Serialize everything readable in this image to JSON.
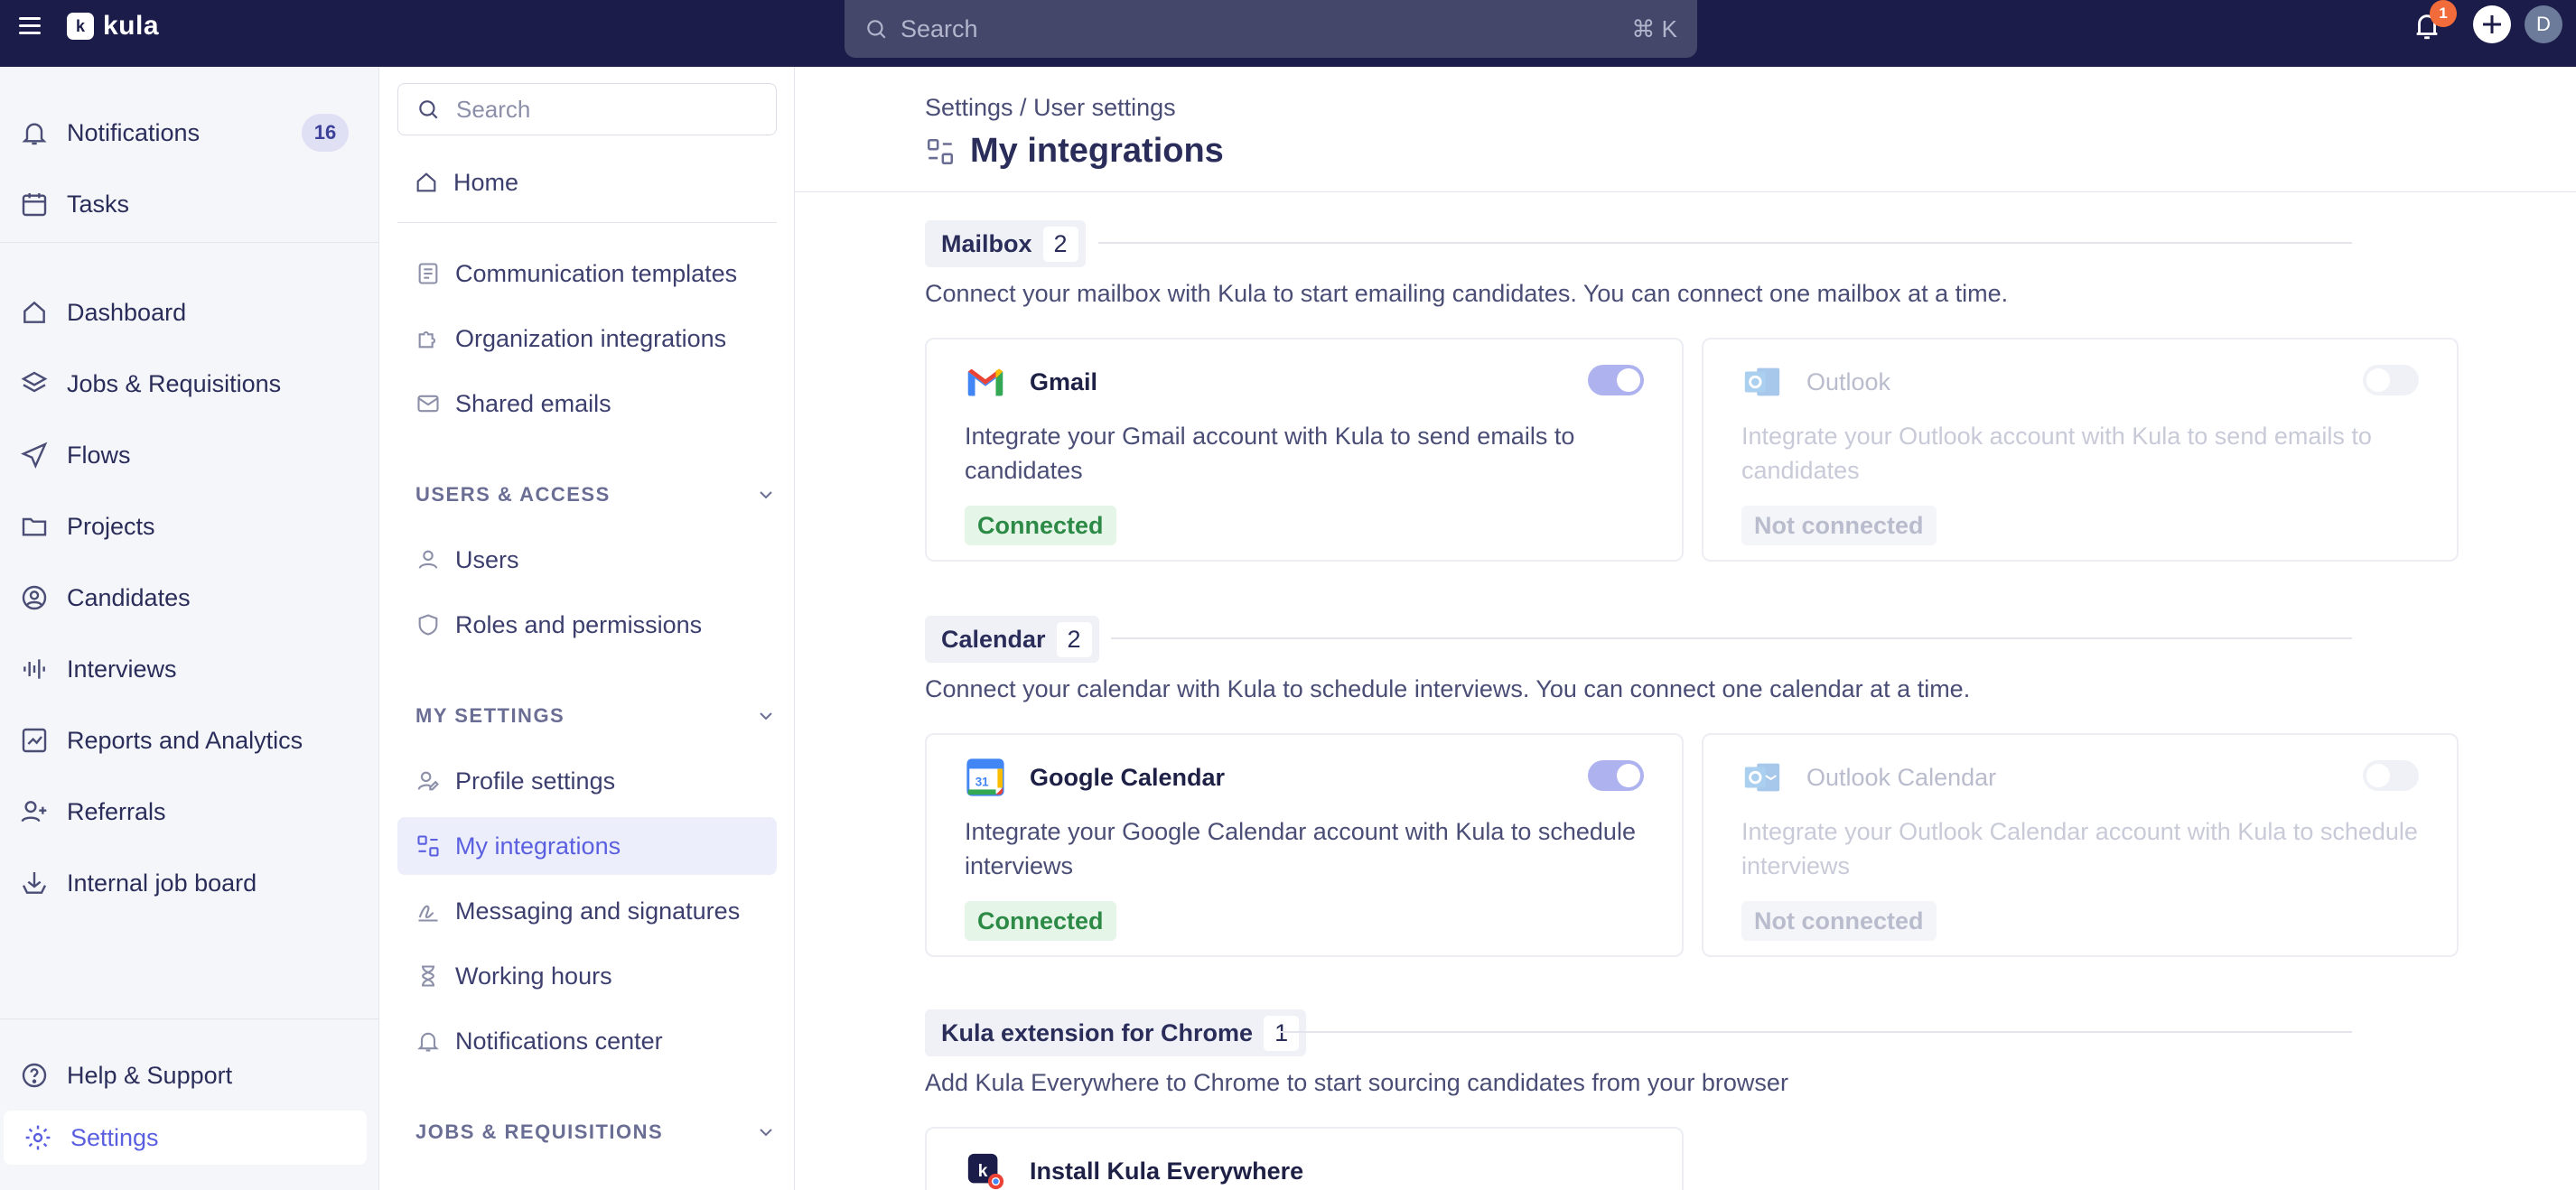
{
  "app": {
    "name": "kula",
    "logo_mark": "k"
  },
  "topbar": {
    "search_placeholder": "Search",
    "shortcut": "⌘ K",
    "notif_badge": "1",
    "avatar_initial": "D"
  },
  "leftnav": {
    "items": [
      {
        "label": "Notifications",
        "icon": "bell-icon",
        "count": "16"
      },
      {
        "label": "Tasks",
        "icon": "calendar-check-icon"
      },
      {
        "label": "Dashboard",
        "icon": "home-icon"
      },
      {
        "label": "Jobs & Requisitions",
        "icon": "layers-icon"
      },
      {
        "label": "Flows",
        "icon": "send-icon"
      },
      {
        "label": "Projects",
        "icon": "folder-icon"
      },
      {
        "label": "Candidates",
        "icon": "user-circle-icon"
      },
      {
        "label": "Interviews",
        "icon": "audio-bars-icon"
      },
      {
        "label": "Reports and Analytics",
        "icon": "chart-icon"
      },
      {
        "label": "Referrals",
        "icon": "user-plus-icon"
      },
      {
        "label": "Internal job board",
        "icon": "inbox-stack-icon"
      }
    ],
    "help_label": "Help & Support",
    "settings_label": "Settings"
  },
  "subnav": {
    "search_placeholder": "Search",
    "home": "Home",
    "org_items": [
      "Communication templates",
      "Organization integrations",
      "Shared emails"
    ],
    "users_section": "USERS & ACCESS",
    "users_items": [
      "Users",
      "Roles and permissions"
    ],
    "my_section": "MY SETTINGS",
    "my_items": [
      "Profile settings",
      "My integrations",
      "Messaging and signatures",
      "Working hours",
      "Notifications center"
    ],
    "jobs_section": "JOBS & REQUISITIONS"
  },
  "main": {
    "breadcrumb": "Settings / User settings",
    "title": "My integrations",
    "sections": [
      {
        "name": "Mailbox",
        "count": "2",
        "description": "Connect your mailbox with Kula to start emailing candidates. You can connect one mailbox at a time.",
        "cards": [
          {
            "name": "Gmail",
            "description": "Integrate your Gmail account with Kula to send emails to candidates",
            "status": "Connected",
            "enabled": true
          },
          {
            "name": "Outlook",
            "description": "Integrate your Outlook account with Kula to send emails to candidates",
            "status": "Not connected",
            "enabled": false
          }
        ]
      },
      {
        "name": "Calendar",
        "count": "2",
        "description": "Connect your calendar with Kula to schedule interviews. You can connect one calendar at a time.",
        "cards": [
          {
            "name": "Google Calendar",
            "description": "Integrate your Google Calendar account with Kula to schedule interviews",
            "status": "Connected",
            "enabled": true,
            "logo_text": "31"
          },
          {
            "name": "Outlook Calendar",
            "description": "Integrate your Outlook Calendar account with Kula to schedule interviews",
            "status": "Not connected",
            "enabled": false
          }
        ]
      },
      {
        "name": "Kula extension for Chrome",
        "count": "1",
        "description": "Add Kula Everywhere to Chrome to start sourcing candidates from your browser",
        "cards": [
          {
            "name": "Install Kula Everywhere"
          }
        ]
      }
    ]
  },
  "colors": {
    "topbar": "#1c1c4a",
    "accent": "#5a5fe0",
    "connected_bg": "#e5f6e9",
    "connected_text": "#2d8a46"
  }
}
